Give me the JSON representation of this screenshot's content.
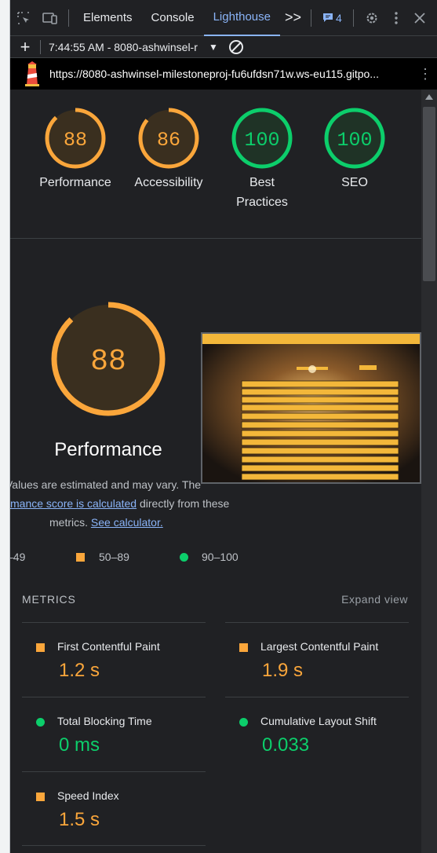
{
  "devtools": {
    "tabs": [
      "Elements",
      "Console",
      "Lighthouse"
    ],
    "more_tabs": ">>",
    "issues_count": "4",
    "report_selector": "7:44:55 AM - 8080-ashwinsel-r"
  },
  "url": "https://8080-ashwinsel-milestoneproj-fu6ufdsn71w.ws-eu115.gitpo...",
  "scores": [
    {
      "value": "88",
      "label": "Performance",
      "status": "average"
    },
    {
      "value": "86",
      "label": "Accessibility",
      "status": "average"
    },
    {
      "value": "100",
      "label": "Best",
      "label2": "Practices",
      "status": "pass"
    },
    {
      "value": "100",
      "label": "SEO",
      "status": "pass"
    }
  ],
  "colors": {
    "average": "#faa63b",
    "pass": "#0cce6b",
    "average_bg": "#3a2f1f",
    "pass_bg": "#1f3326"
  },
  "performance": {
    "score": "88",
    "title": "Performance",
    "note_line1": "Values are estimated and may vary. The",
    "note_link1": "mance score is calculated",
    "note_line2_rest": " directly from these",
    "note_line3": "metrics. ",
    "note_link2": "See calculator."
  },
  "legend": {
    "fail": "–49",
    "average": "50–89",
    "pass": "90–100"
  },
  "metrics": {
    "heading": "METRICS",
    "expand": "Expand view",
    "items": [
      {
        "name": "First Contentful Paint",
        "value": "1.2 s",
        "status": "average"
      },
      {
        "name": "Largest Contentful Paint",
        "value": "1.9 s",
        "status": "average"
      },
      {
        "name": "Total Blocking Time",
        "value": "0 ms",
        "status": "pass"
      },
      {
        "name": "Cumulative Layout Shift",
        "value": "0.033",
        "status": "pass"
      },
      {
        "name": "Speed Index",
        "value": "1.5 s",
        "status": "average"
      }
    ]
  }
}
